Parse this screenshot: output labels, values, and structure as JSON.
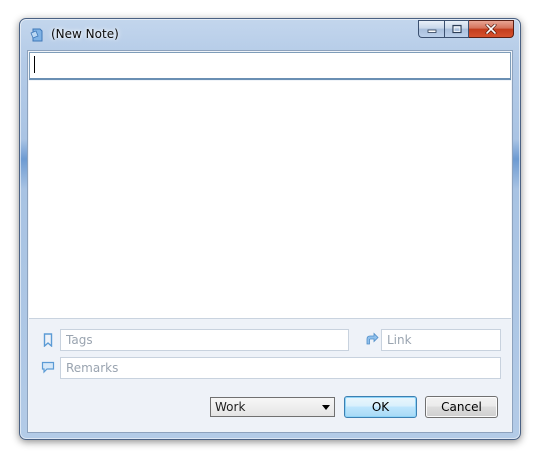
{
  "window": {
    "title": "(New Note)",
    "minimize_label": "Minimize",
    "maximize_label": "Maximize",
    "close_label": "Close"
  },
  "note": {
    "title_value": "",
    "body_value": ""
  },
  "fields": {
    "tags_placeholder": "Tags",
    "link_placeholder": "Link",
    "remarks_placeholder": "Remarks"
  },
  "category": {
    "selected": "Work"
  },
  "buttons": {
    "ok_label": "OK",
    "cancel_label": "Cancel"
  },
  "icons": {
    "app": "note-icon",
    "tags": "bookmark-icon",
    "link": "link-arrow-icon",
    "remarks": "speech-bubble-icon"
  },
  "colors": {
    "icon_accent": "#5b9bd5",
    "close_button": "#c23c1c",
    "ok_border": "#3c7fb1"
  }
}
